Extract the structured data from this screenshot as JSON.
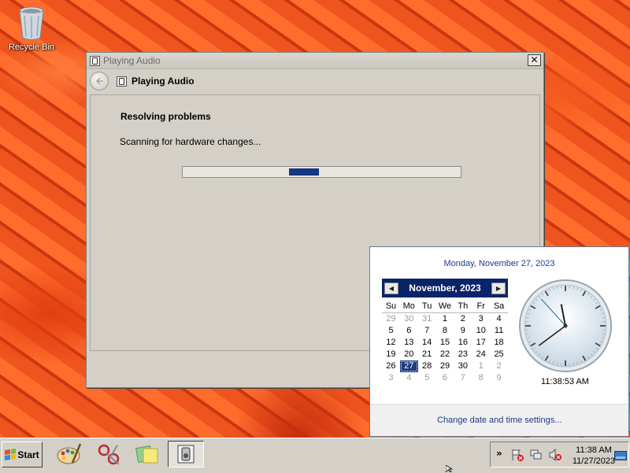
{
  "desktop": {
    "recycle_bin_label": "Recycle Bin"
  },
  "window": {
    "title": "Playing Audio",
    "nav_title": "Playing Audio",
    "close_glyph": "✕",
    "heading": "Resolving problems",
    "status": "Scanning for hardware changes...",
    "progress": {
      "indeterminate": true,
      "marquee_position": 0.38
    }
  },
  "calendar_flyout": {
    "long_date": "Monday, November 27, 2023",
    "month_label": "November, 2023",
    "prev_glyph": "◀",
    "next_glyph": "▶",
    "weekdays": [
      "Su",
      "Mo",
      "Tu",
      "We",
      "Th",
      "Fr",
      "Sa"
    ],
    "weeks": [
      [
        "29",
        "30",
        "31",
        "1",
        "2",
        "3",
        "4"
      ],
      [
        "5",
        "6",
        "7",
        "8",
        "9",
        "10",
        "11"
      ],
      [
        "12",
        "13",
        "14",
        "15",
        "16",
        "17",
        "18"
      ],
      [
        "19",
        "20",
        "21",
        "22",
        "23",
        "24",
        "25"
      ],
      [
        "26",
        "27",
        "28",
        "29",
        "30",
        "1",
        "2"
      ],
      [
        "3",
        "4",
        "5",
        "6",
        "7",
        "8",
        "9"
      ]
    ],
    "selected_day": "27",
    "clock_time": "11:38:53 AM",
    "clock": {
      "hour": 11,
      "minute": 38,
      "second": 53
    },
    "settings_link": "Change date and time settings..."
  },
  "taskbar": {
    "start_label": "Start",
    "tray_time": "11:38 AM",
    "tray_date": "11/27/2023",
    "show_hidden_glyph": "»"
  },
  "colors": {
    "accent": "#0a246a",
    "link": "#1e3b8a",
    "progress": "#153680",
    "error": "#d21a1a"
  }
}
